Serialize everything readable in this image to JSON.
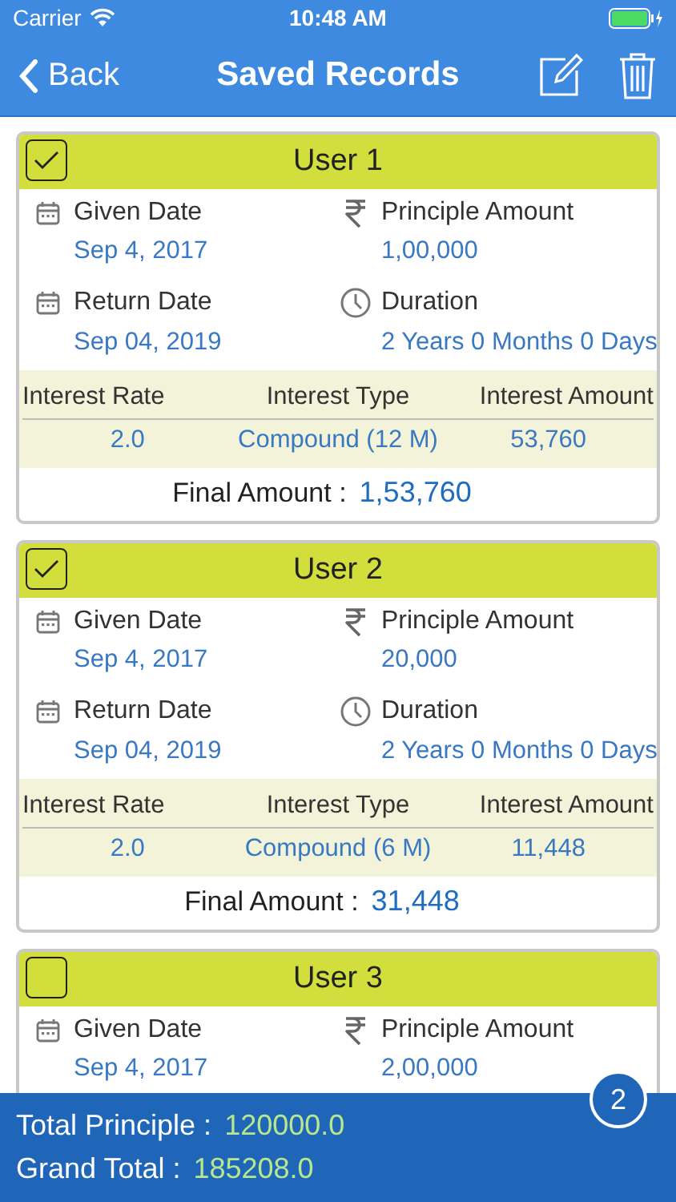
{
  "status_bar": {
    "carrier": "Carrier",
    "time": "10:48 AM"
  },
  "nav": {
    "back": "Back",
    "title": "Saved Records"
  },
  "records": [
    {
      "title": "User 1",
      "checked": true,
      "fields": [
        {
          "kind": "date",
          "label": "Given Date",
          "value": "Sep 4, 2017"
        },
        {
          "kind": "amount",
          "label": "Principle Amount",
          "value": "1,00,000"
        },
        {
          "kind": "date",
          "label": "Return Date",
          "value": "Sep 04, 2019"
        },
        {
          "kind": "duration",
          "label": "Duration",
          "value": "2 Years 0 Months 0 Days"
        }
      ],
      "interest": {
        "columns": [
          "Interest Rate",
          "Interest Type",
          "Interest Amount"
        ],
        "values": [
          "2.0",
          "Compound (12 M)",
          "53,760"
        ]
      },
      "final_label": "Final Amount :",
      "final_value": "1,53,760"
    },
    {
      "title": "User 2",
      "checked": true,
      "fields": [
        {
          "kind": "date",
          "label": "Given Date",
          "value": "Sep 4, 2017"
        },
        {
          "kind": "amount",
          "label": "Principle Amount",
          "value": "20,000"
        },
        {
          "kind": "date",
          "label": "Return Date",
          "value": "Sep 04, 2019"
        },
        {
          "kind": "duration",
          "label": "Duration",
          "value": "2 Years 0 Months 0 Days"
        }
      ],
      "interest": {
        "columns": [
          "Interest Rate",
          "Interest Type",
          "Interest Amount"
        ],
        "values": [
          "2.0",
          "Compound (6 M)",
          "11,448"
        ]
      },
      "final_label": "Final Amount :",
      "final_value": "31,448"
    },
    {
      "title": "User 3",
      "checked": false,
      "fields": [
        {
          "kind": "date",
          "label": "Given Date",
          "value": "Sep 4, 2017"
        },
        {
          "kind": "amount",
          "label": "Principle Amount",
          "value": "2,00,000"
        }
      ]
    }
  ],
  "selected_count": "2",
  "totals": [
    {
      "label": "Total Principle :",
      "value": "120000.0"
    },
    {
      "label": "Grand Total :",
      "value": "185208.0"
    }
  ]
}
